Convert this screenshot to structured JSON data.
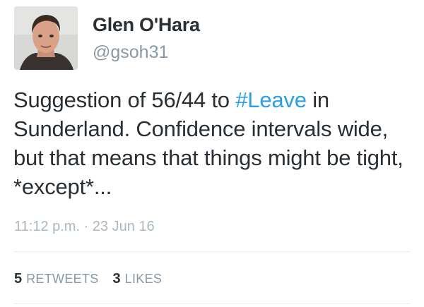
{
  "user": {
    "name": "Glen O'Hara",
    "handle": "@gsoh31"
  },
  "tweet": {
    "text_before": "Suggestion of 56/44 to ",
    "hashtag": "#Leave",
    "text_after": " in Sunderland. Confidence intervals wide, but that means that things might be tight, *except*...",
    "timestamp": "11:12 p.m. · 23 Jun 16",
    "hashtag_color": "#2a9fe6"
  },
  "stats": {
    "retweets_count": "5",
    "retweets_label": "RETWEETS",
    "likes_count": "3",
    "likes_label": "LIKES"
  }
}
